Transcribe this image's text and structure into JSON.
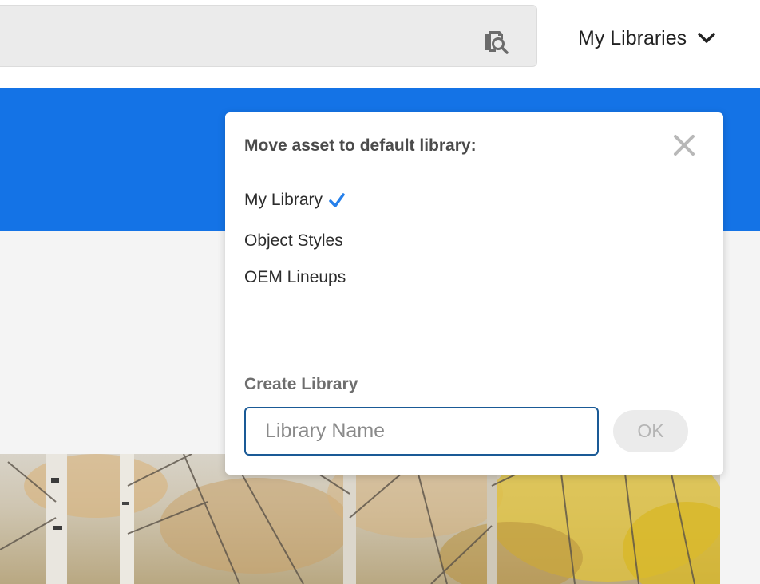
{
  "header": {
    "search_icon": "asset-search-icon",
    "libraries_label": "My Libraries",
    "libraries_icon": "chevron-down-icon"
  },
  "colors": {
    "accent_blue": "#1473e6",
    "check_blue": "#2680eb",
    "input_border": "#1a5a96"
  },
  "popover": {
    "title": "Move asset to default library:",
    "close_icon": "close-icon",
    "libraries": [
      {
        "label": "My Library",
        "selected": true
      },
      {
        "label": "Object Styles",
        "selected": false
      },
      {
        "label": "OEM Lineups",
        "selected": false
      }
    ],
    "create_label": "Create Library",
    "name_placeholder": "Library Name",
    "name_value": "",
    "ok_label": "OK"
  }
}
